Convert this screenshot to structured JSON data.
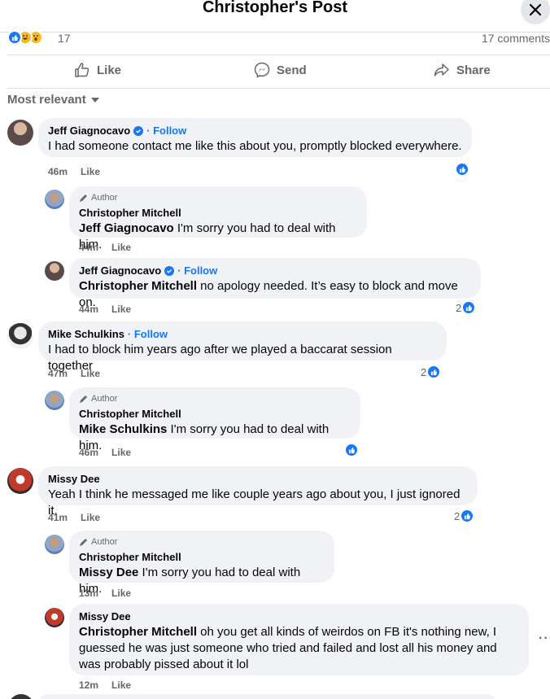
{
  "header": {
    "title": "Christopher's Post",
    "close_icon": "close-icon"
  },
  "reactions": {
    "count": "17",
    "comments": "17 comments",
    "icons": [
      "like-reaction-icon",
      "haha-reaction-icon",
      "wow-reaction-icon"
    ]
  },
  "actions": {
    "like": "Like",
    "send": "Send",
    "share": "Share"
  },
  "sort": {
    "label": "Most relevant"
  },
  "labels": {
    "follow": "· Follow",
    "author": "Author",
    "like": "Like"
  },
  "comments": [
    {
      "name": "Jeff Giagnocavo",
      "verified": true,
      "follow": true,
      "text": "I had someone contact me like this about you, promptly blocked everywhere.",
      "time": "46m",
      "likes": ""
    },
    {
      "name": "Christopher Mitchell",
      "author": true,
      "mention": "Jeff Giagnocavo",
      "text": " I'm sorry you had to deal with him.",
      "time": "44m",
      "likes": null
    },
    {
      "name": "Jeff Giagnocavo",
      "verified": true,
      "follow": true,
      "mention": "Christopher Mitchell",
      "text": " no apology needed. It’s easy to block and move on.",
      "time": "44m",
      "likes": "2"
    },
    {
      "name": "Mike Schulkins",
      "follow": true,
      "text": "I had to block him years ago after we played a baccarat session together",
      "time": "47m",
      "likes": "2"
    },
    {
      "name": "Christopher Mitchell",
      "author": true,
      "mention": "Mike Schulkins",
      "text": " I'm sorry you had to deal with him.",
      "time": "46m",
      "likes": ""
    },
    {
      "name": "Missy Dee",
      "text": "Yeah I think he messaged me like couple years ago about you, I just ignored it.",
      "time": "41m",
      "likes": "2"
    },
    {
      "name": "Christopher Mitchell",
      "author": true,
      "mention": "Missy Dee",
      "text": " I'm sorry you had to deal with him.",
      "time": "13m",
      "likes": null
    },
    {
      "name": "Missy Dee",
      "mention": "Christopher Mitchell",
      "text": " oh you get all kinds of weirdos on FB it's nothing new, I guessed he was just someone who tried and failed and lost all his money and was probably pissed about it lol",
      "time": "12m",
      "likes": null
    }
  ],
  "more_options": "···",
  "colors": {
    "accent": "#1877f2",
    "bubble": "#f0f2f5",
    "muted": "#65676b"
  }
}
